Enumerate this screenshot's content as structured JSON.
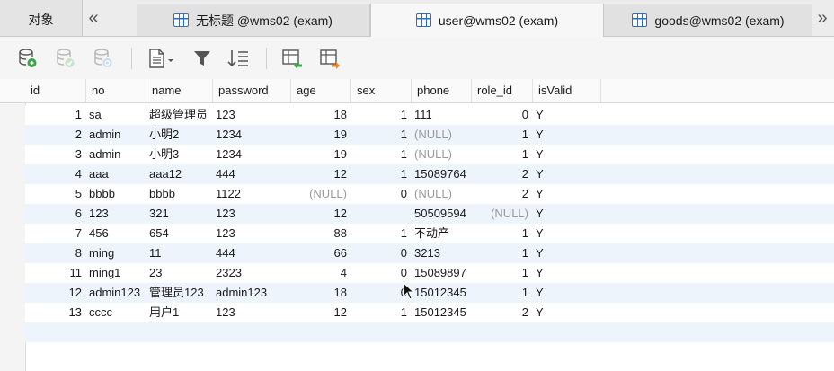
{
  "tabs": {
    "objects_label": "对象",
    "collapse_glyph": "«",
    "more_glyph": "»",
    "items": [
      {
        "label": "无标题 @wms02 (exam)",
        "icon": "query-table-icon",
        "active": false
      },
      {
        "label": "user@wms02 (exam)",
        "icon": "table-icon",
        "active": true
      },
      {
        "label": "goods@wms02 (exam)",
        "icon": "table-icon",
        "active": false
      }
    ]
  },
  "toolbar": {
    "buttons": [
      "add-record-icon",
      "save-record-icon",
      "refresh-icon",
      "text-view-icon",
      "filter-icon",
      "sort-icon",
      "import-icon",
      "export-icon"
    ]
  },
  "table": {
    "columns": [
      "id",
      "no",
      "name",
      "password",
      "age",
      "sex",
      "phone",
      "role_id",
      "isValid"
    ],
    "rows": [
      [
        "1",
        "sa",
        "超级管理员",
        "123",
        "18",
        "1",
        "111",
        "0",
        "Y"
      ],
      [
        "2",
        "admin",
        "小明2",
        "1234",
        "19",
        "1",
        "(NULL)",
        "1",
        "Y"
      ],
      [
        "3",
        "admin",
        "小明3",
        "1234",
        "19",
        "1",
        "(NULL)",
        "1",
        "Y"
      ],
      [
        "4",
        "aaa",
        "aaa12",
        "444",
        "12",
        "1",
        "15089764",
        "2",
        "Y"
      ],
      [
        "5",
        "bbbb",
        "bbbb",
        "1122",
        "(NULL)",
        "0",
        "(NULL)",
        "2",
        "Y"
      ],
      [
        "6",
        "123",
        "321",
        "123",
        "12",
        "",
        "50509594",
        "(NULL)",
        "Y"
      ],
      [
        "7",
        "456",
        "654",
        "123",
        "88",
        "1",
        "不动产",
        "1",
        "Y"
      ],
      [
        "8",
        "ming",
        "11",
        "444",
        "66",
        "0",
        "3213",
        "1",
        "Y"
      ],
      [
        "11",
        "ming1",
        "23",
        "2323",
        "4",
        "0",
        "15089897",
        "1",
        "Y"
      ],
      [
        "12",
        "admin123",
        "管理员123",
        "admin123",
        "18",
        "0",
        "15012345",
        "1",
        "Y"
      ],
      [
        "13",
        "cccc",
        "用户1",
        "123",
        "12",
        "1",
        "15012345",
        "2",
        "Y"
      ]
    ]
  }
}
